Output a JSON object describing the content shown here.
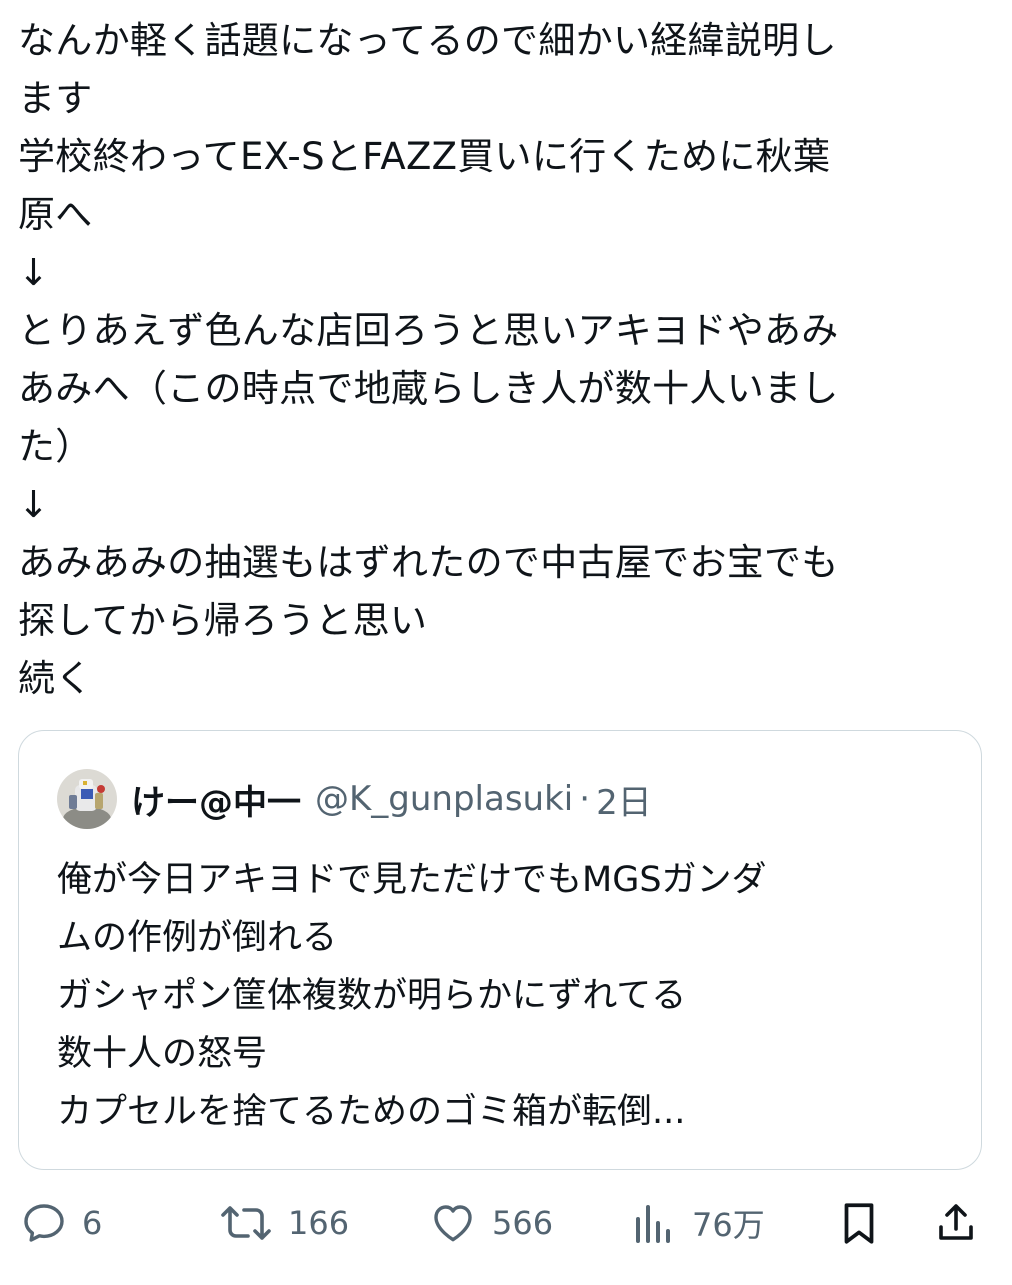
{
  "tweet": {
    "lines": [
      "なんか軽く話題になってるので細かい経緯説明し",
      "ます",
      "学校終わってEX-SとFAZZ買いに行くために秋葉",
      "原へ",
      "↓",
      "とりあえず色んな店回ろうと思いアキヨドやあみ",
      "あみへ（この時点で地蔵らしき人が数十人いまし",
      "た）",
      "↓",
      "あみあみの抽選もはずれたので中古屋でお宝でも",
      "探してから帰ろうと思い",
      "続く"
    ]
  },
  "quote": {
    "author_name": "けー@中一",
    "handle": "@K_gunplasuki",
    "separator": "·",
    "time": "2日",
    "avatar_icon": "avatar-gunpla-figure",
    "lines": [
      "俺が今日アキヨドで見ただけでもMGSガンダ",
      "ムの作例が倒れる",
      "ガシャポン筐体複数が明らかにずれてる",
      "数十人の怒号",
      "カプセルを捨てるためのゴミ箱が転倒..."
    ]
  },
  "actions": {
    "reply": {
      "icon": "reply-icon",
      "count": "6"
    },
    "retweet": {
      "icon": "retweet-icon",
      "count": "166"
    },
    "like": {
      "icon": "heart-icon",
      "count": "566"
    },
    "views": {
      "icon": "views-icon",
      "count": "76万"
    },
    "bookmark": {
      "icon": "bookmark-icon"
    },
    "share": {
      "icon": "share-icon"
    }
  },
  "colors": {
    "text": "#0f1419",
    "secondary": "#536471",
    "border": "#cfd9de"
  }
}
